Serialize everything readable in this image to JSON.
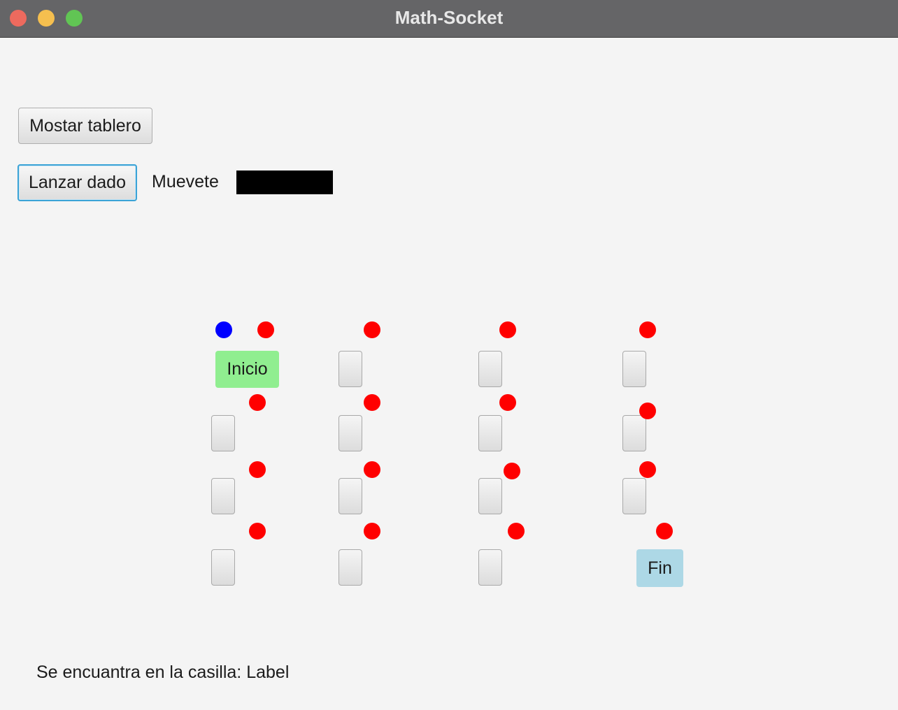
{
  "window": {
    "title": "Math-Socket"
  },
  "controls": {
    "show_board_label": "Mostar tablero",
    "roll_die_label": "Lanzar dado",
    "move_label": "Muevete",
    "status_prefix": "Se encuantra en la casilla:",
    "status_value": "Label"
  },
  "board": {
    "start_label": "Inicio",
    "end_label": "Fin",
    "start_color": "#90ee90",
    "end_color": "#add8e6",
    "player_token_color": "#0000ff",
    "marker_color": "#ff0000"
  }
}
